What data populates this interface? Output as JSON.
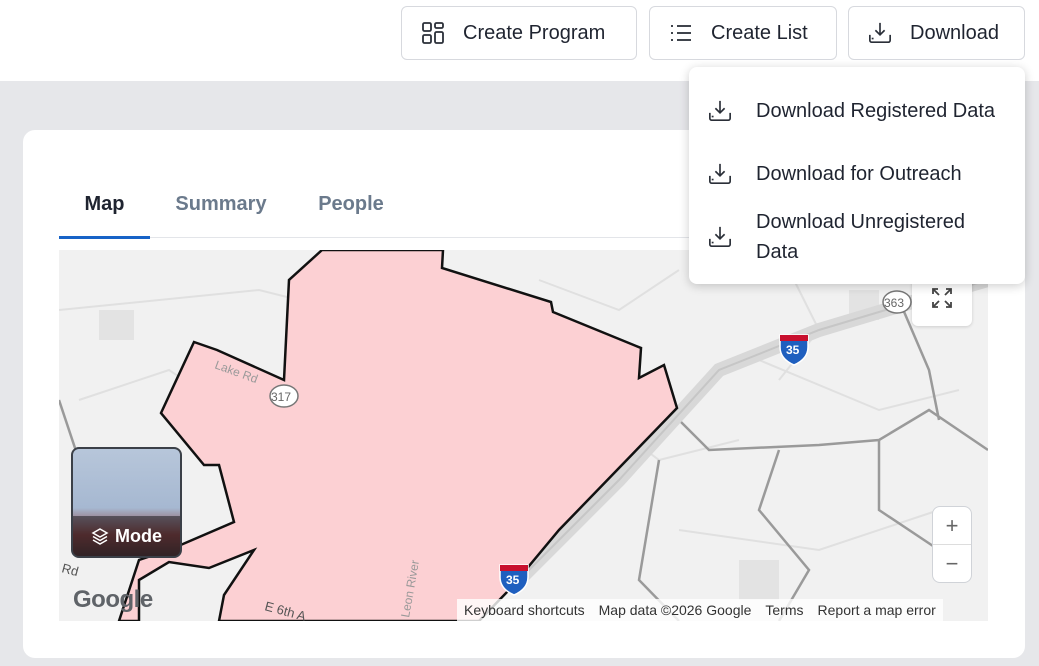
{
  "toolbar": {
    "create_program": "Create Program",
    "create_list": "Create List",
    "download": "Download"
  },
  "download_menu": {
    "items": [
      {
        "label": "Download Registered Data",
        "icon": "download-icon"
      },
      {
        "label": "Download for Outreach",
        "icon": "download-icon"
      },
      {
        "label": "Download Unregistered Data",
        "icon": "download-icon"
      }
    ]
  },
  "tabs": [
    {
      "label": "Map",
      "active": true
    },
    {
      "label": "Summary",
      "active": false
    },
    {
      "label": "People",
      "active": false
    }
  ],
  "map": {
    "mode_label": "Mode",
    "logo": "Google",
    "attribution": {
      "shortcuts": "Keyboard shortcuts",
      "data": "Map data ©2026 Google",
      "terms": "Terms",
      "report": "Report a map error"
    },
    "zoom_in": "+",
    "zoom_out": "−",
    "labels": {
      "road_lake": "Lake Rd",
      "route_317": "317",
      "route_363": "363",
      "interstate_35": "35",
      "interstate_35b": "35",
      "road_6th": "E 6th A",
      "river": "Leon River",
      "road_rd": "Rd"
    }
  },
  "colors": {
    "accent": "#1763c7",
    "region_fill": "#fcd0d3",
    "map_bg": "#f1f1f1"
  }
}
